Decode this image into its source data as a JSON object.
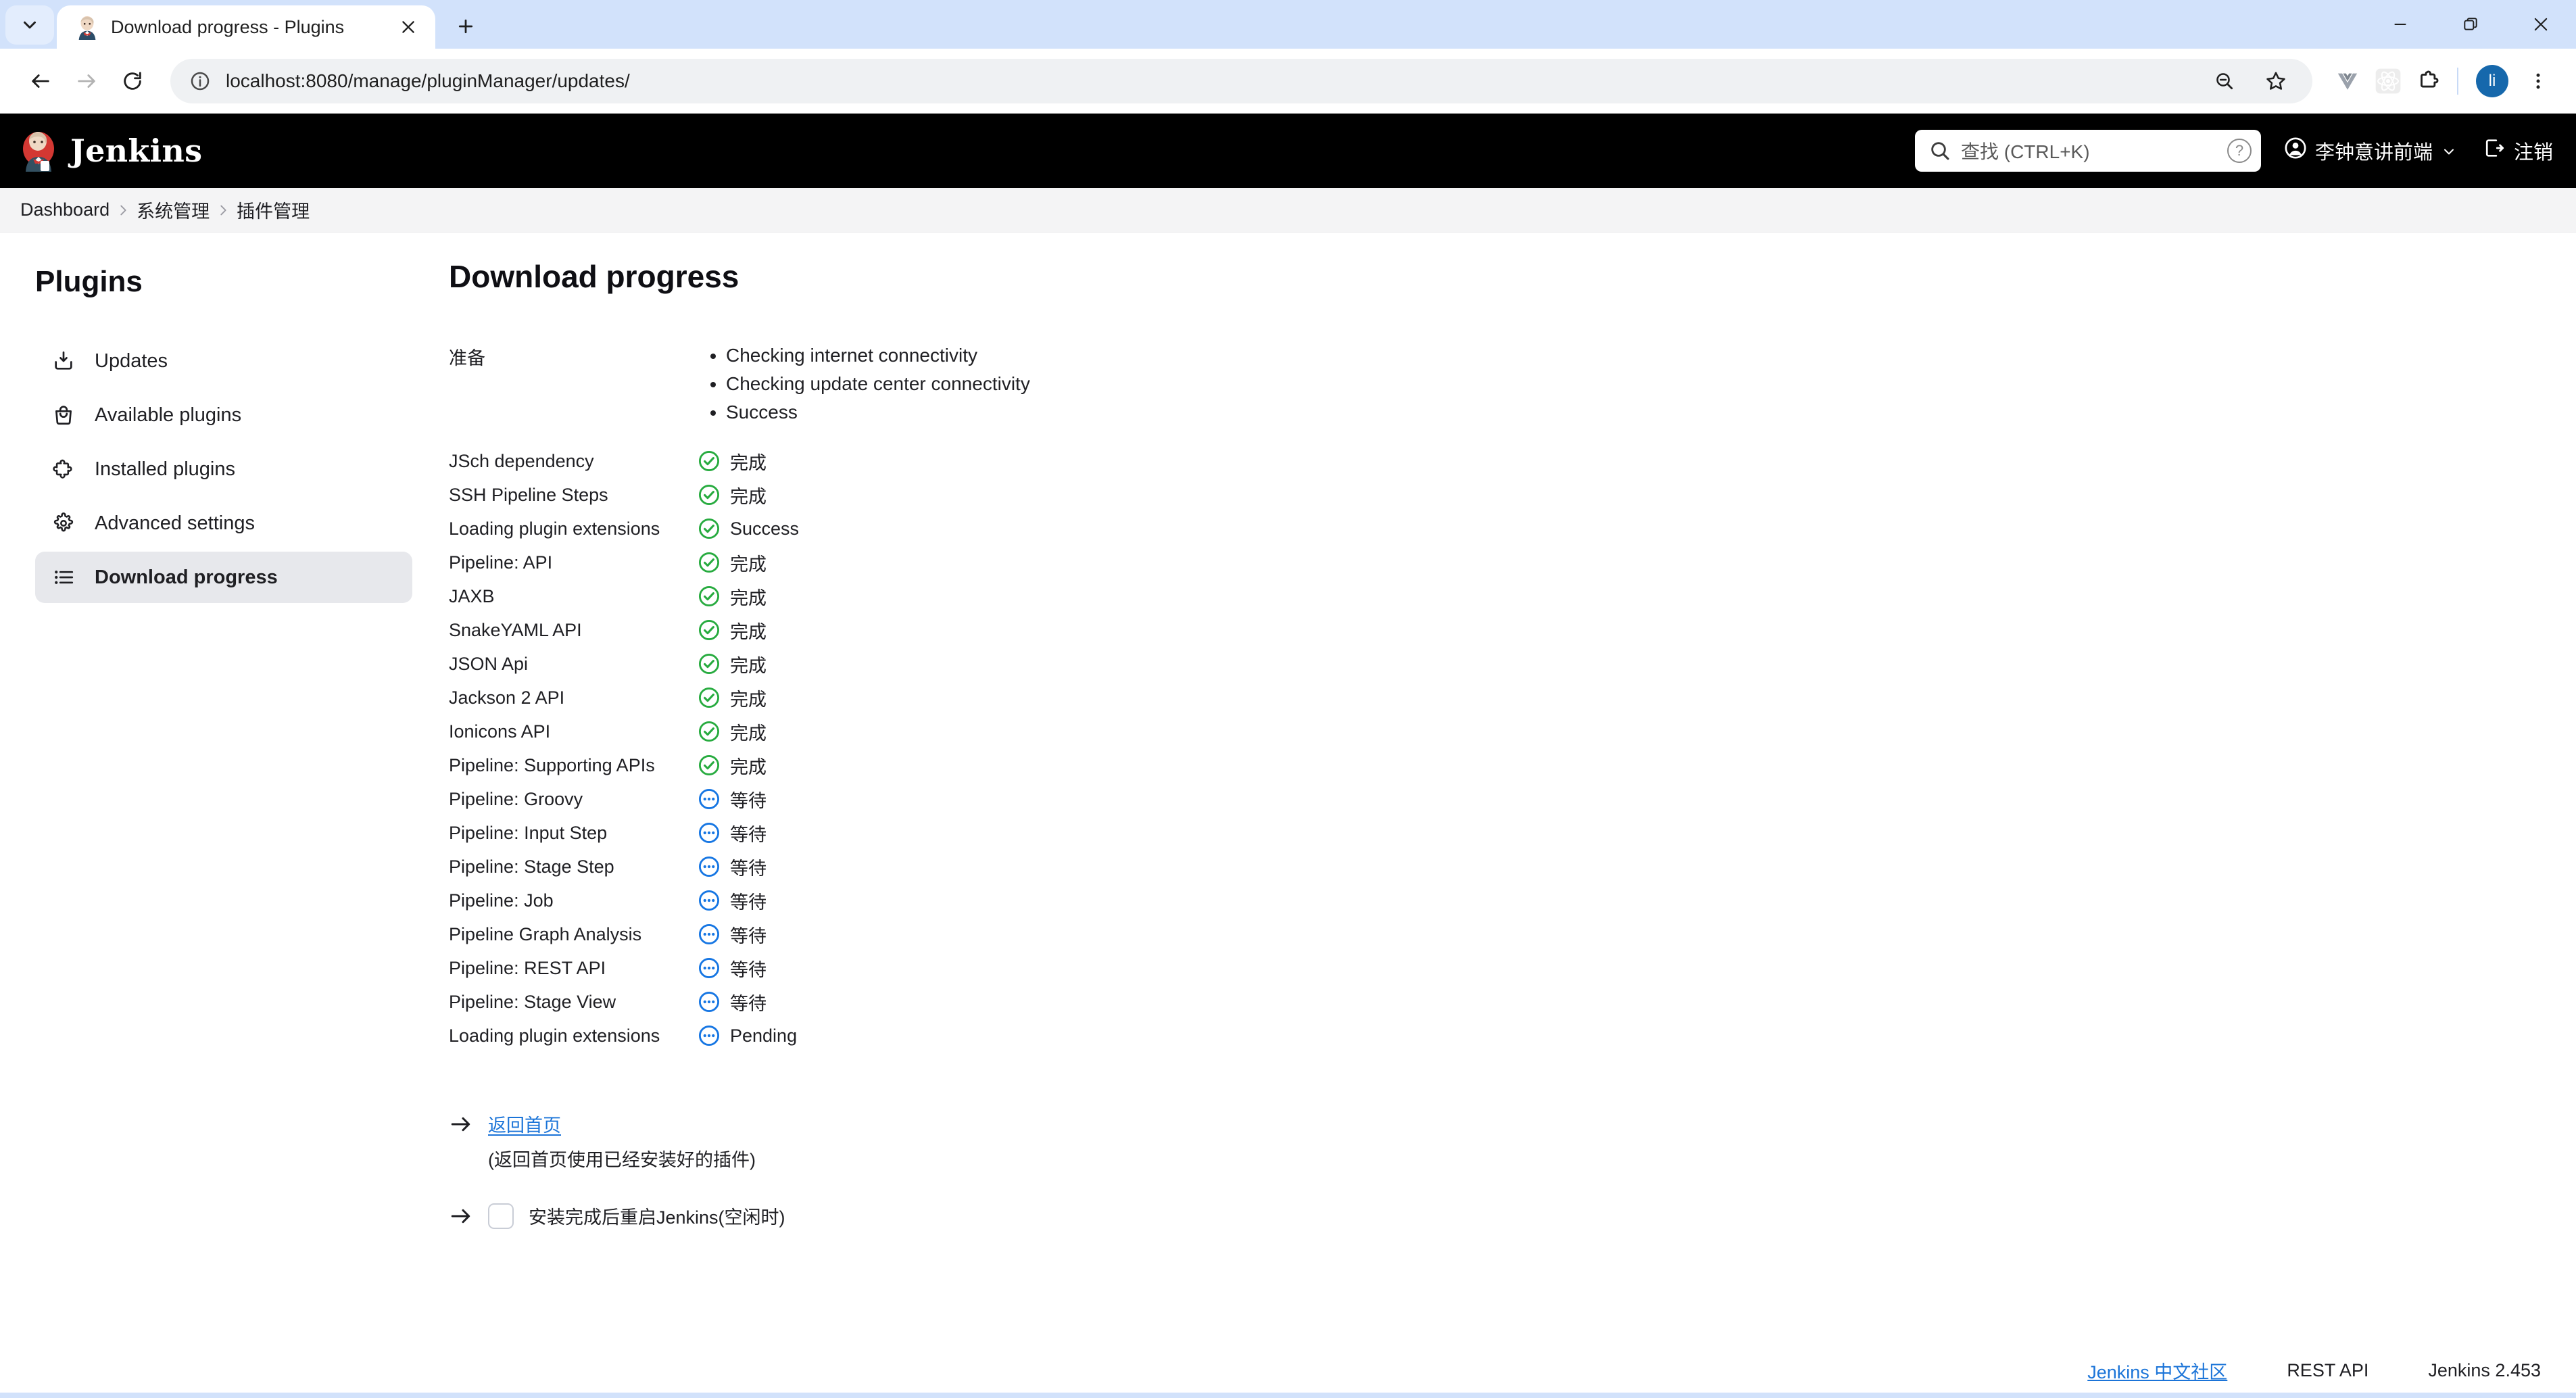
{
  "browser": {
    "tab": {
      "title": "Download progress - Plugins",
      "favicon_icon": "jenkins-favicon-icon",
      "close_icon": "close-icon"
    },
    "tab_list_icon": "chevron-down-icon",
    "new_tab_icon": "plus-icon",
    "window_controls": {
      "minimize_icon": "minimize-icon",
      "maximize_icon": "restore-icon",
      "close_icon": "window-close-icon"
    },
    "nav": {
      "back_icon": "back-arrow-icon",
      "forward_icon": "forward-arrow-icon",
      "reload_icon": "reload-icon"
    },
    "omnibox": {
      "info_icon": "page-info-icon",
      "url": "localhost:8080/manage/pluginManager/updates/",
      "zoom_out_icon": "zoom-out-icon",
      "bookmark_icon": "star-icon"
    },
    "extensions": [
      {
        "name": "vue-devtools-icon"
      },
      {
        "name": "react-devtools-icon"
      },
      {
        "name": "extensions-puzzle-icon"
      }
    ],
    "profile": {
      "initials": "li"
    },
    "menu_icon": "three-dot-menu-icon"
  },
  "jenkins": {
    "brand": "Jenkins",
    "logo_icon": "jenkins-butler-icon",
    "search": {
      "icon": "search-icon",
      "placeholder": "查找 (CTRL+K)",
      "help_icon": "help-icon",
      "help_label": "?"
    },
    "user": {
      "avatar_icon": "user-circle-icon",
      "name": "李钟意讲前端",
      "chevron_icon": "chevron-down-icon"
    },
    "logout": {
      "icon": "logout-icon",
      "label": "注销"
    },
    "breadcrumb": [
      {
        "label": "Dashboard"
      },
      {
        "label": "系统管理"
      },
      {
        "label": "插件管理"
      }
    ],
    "sidebar": {
      "title": "Plugins",
      "items": [
        {
          "label": "Updates",
          "icon": "download-box-icon",
          "active": false
        },
        {
          "label": "Available plugins",
          "icon": "shopping-bag-icon",
          "active": false
        },
        {
          "label": "Installed plugins",
          "icon": "puzzle-piece-icon",
          "active": false
        },
        {
          "label": "Advanced settings",
          "icon": "gear-icon",
          "active": false
        },
        {
          "label": "Download progress",
          "icon": "list-icon",
          "active": true
        }
      ]
    },
    "main": {
      "page_title": "Download progress",
      "prepare": {
        "label": "准备",
        "steps": [
          "Checking internet connectivity",
          "Checking update center connectivity",
          "Success"
        ]
      },
      "plugins": [
        {
          "name": "JSch dependency",
          "status": "完成",
          "state": "success"
        },
        {
          "name": "SSH Pipeline Steps",
          "status": "完成",
          "state": "success"
        },
        {
          "name": "Loading plugin extensions",
          "status": "Success",
          "state": "success"
        },
        {
          "name": "Pipeline: API",
          "status": "完成",
          "state": "success"
        },
        {
          "name": "JAXB",
          "status": "完成",
          "state": "success"
        },
        {
          "name": "SnakeYAML API",
          "status": "完成",
          "state": "success"
        },
        {
          "name": "JSON Api",
          "status": "完成",
          "state": "success"
        },
        {
          "name": "Jackson 2 API",
          "status": "完成",
          "state": "success"
        },
        {
          "name": "Ionicons API",
          "status": "完成",
          "state": "success"
        },
        {
          "name": "Pipeline: Supporting APIs",
          "status": "完成",
          "state": "success"
        },
        {
          "name": "Pipeline: Groovy",
          "status": "等待",
          "state": "pending"
        },
        {
          "name": "Pipeline: Input Step",
          "status": "等待",
          "state": "pending"
        },
        {
          "name": "Pipeline: Stage Step",
          "status": "等待",
          "state": "pending"
        },
        {
          "name": "Pipeline: Job",
          "status": "等待",
          "state": "pending"
        },
        {
          "name": "Pipeline Graph Analysis",
          "status": "等待",
          "state": "pending"
        },
        {
          "name": "Pipeline: REST API",
          "status": "等待",
          "state": "pending"
        },
        {
          "name": "Pipeline: Stage View",
          "status": "等待",
          "state": "pending"
        },
        {
          "name": "Loading plugin extensions",
          "status": "Pending",
          "state": "pending"
        }
      ],
      "actions": {
        "home_link": "返回首页",
        "home_note": "(返回首页使用已经安装好的插件)",
        "restart_label": "安装完成后重启Jenkins(空闲时)",
        "restart_checked": false
      }
    },
    "footer": {
      "community_link": "Jenkins 中文社区",
      "rest_api": "REST API",
      "version": "Jenkins 2.453"
    }
  },
  "colors": {
    "success_green": "#27ab3f",
    "pending_blue": "#1676e3",
    "link_blue": "#1b74d8",
    "header_black": "#000000",
    "chrome_blue": "#d2e2fb",
    "sidebar_active": "#e7e8ec"
  }
}
